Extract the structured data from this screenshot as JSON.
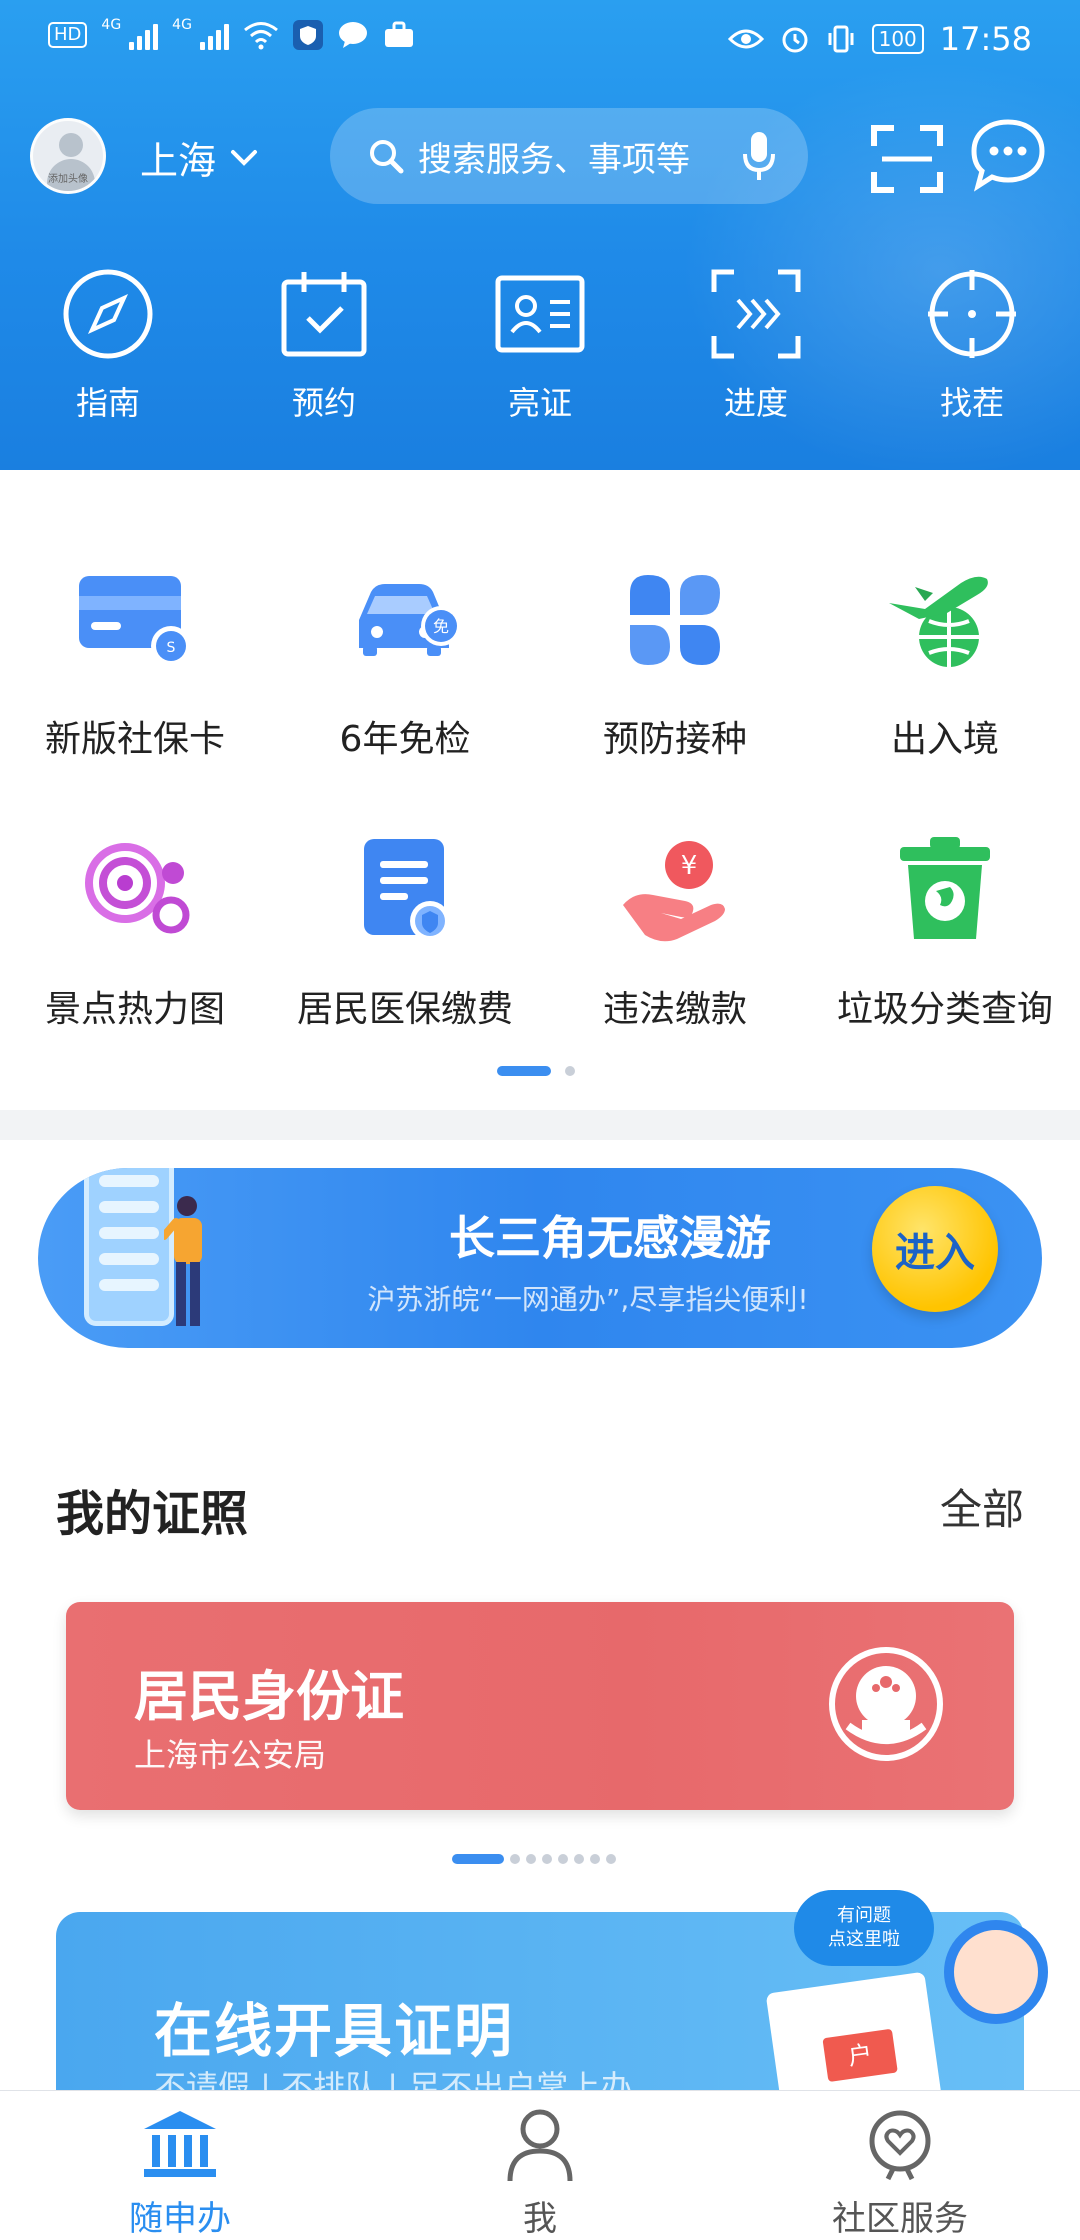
{
  "status_bar": {
    "hd": "HD",
    "net1": "4G",
    "net2": "4G",
    "battery": "100",
    "time": "17:58"
  },
  "header": {
    "avatar_caption": "添加头像",
    "city": "上海",
    "search_placeholder": "搜索服务、事项等"
  },
  "quick_actions": [
    {
      "label": "指南",
      "icon": "compass-icon"
    },
    {
      "label": "预约",
      "icon": "calendar-check-icon"
    },
    {
      "label": "亮证",
      "icon": "id-card-icon"
    },
    {
      "label": "进度",
      "icon": "progress-arrows-icon"
    },
    {
      "label": "找茬",
      "icon": "crosshair-icon"
    }
  ],
  "services": [
    {
      "label": "新版社保卡",
      "icon": "social-security-card-icon"
    },
    {
      "label": "6年免检",
      "icon": "car-exempt-icon"
    },
    {
      "label": "预防接种",
      "icon": "clover-icon"
    },
    {
      "label": "出入境",
      "icon": "plane-globe-icon"
    },
    {
      "label": "景点热力图",
      "icon": "heatmap-circles-icon"
    },
    {
      "label": "居民医保缴费",
      "icon": "medical-insurance-doc-icon"
    },
    {
      "label": "违法缴款",
      "icon": "hand-coin-icon"
    },
    {
      "label": "垃圾分类查询",
      "icon": "trash-bin-icon"
    }
  ],
  "banner": {
    "title": "长三角无感漫游",
    "subtitle": "沪苏浙皖“一网通办”,尽享指尖便利!",
    "button": "进入"
  },
  "certificates": {
    "section_title": "我的证照",
    "all_link": "全部",
    "card_title": "居民身份证",
    "card_issuer": "上海市公安局"
  },
  "online_certificate": {
    "title": "在线开具证明",
    "subtitle": "不请假 | 不排队 | 足不出户掌上办",
    "doc_tag": "户"
  },
  "helper": {
    "bubble": "有问题\n点这里啦"
  },
  "bottom_nav": [
    {
      "label": "随申办",
      "icon": "government-building-icon",
      "active": true
    },
    {
      "label": "我",
      "icon": "person-icon",
      "active": false
    },
    {
      "label": "社区服务",
      "icon": "community-heart-icon",
      "active": false
    }
  ],
  "colors": {
    "header_blue": "#1f8ae8",
    "accent_blue": "#2a8ef0",
    "id_card_red": "#e7696b",
    "enter_yellow": "#ffc400"
  }
}
